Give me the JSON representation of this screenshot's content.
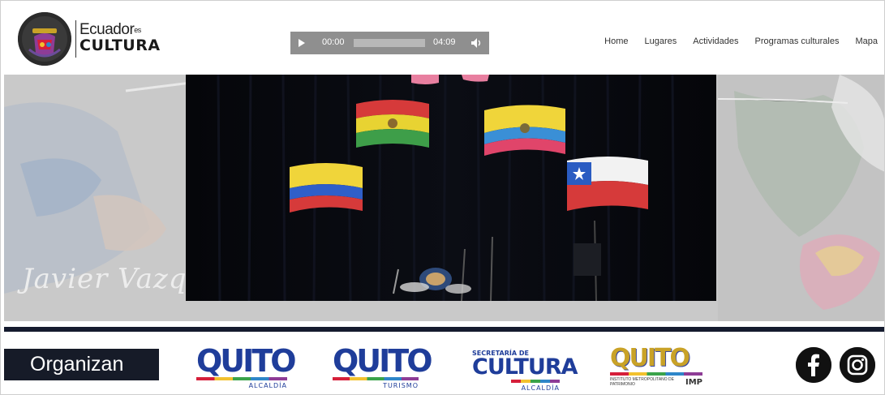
{
  "brand": {
    "line1": "Ecuador",
    "line1_suffix": "es",
    "line2": "CULTURA"
  },
  "player": {
    "current_time": "00:00",
    "total_time": "04:09",
    "progress": 0.0
  },
  "nav": {
    "items": [
      {
        "label": "Home"
      },
      {
        "label": "Lugares"
      },
      {
        "label": "Actividades"
      },
      {
        "label": "Programas culturales"
      },
      {
        "label": "Mapa"
      }
    ]
  },
  "hero": {
    "signature": "Javier Vazque"
  },
  "footer": {
    "organizan_label": "Organizan",
    "sponsors": [
      {
        "name": "QUITO",
        "sub": "ALCALDÍA"
      },
      {
        "name": "QUITO",
        "sub": "TURISMO"
      },
      {
        "top": "SECRETARÍA DE",
        "name": "CULTURA",
        "sub": "ALCALDÍA"
      },
      {
        "name": "QUITO",
        "sub_small": "INSTITUTO METROPOLITANO DE PATRIMONIO",
        "sub": "IMP"
      }
    ],
    "social": [
      {
        "icon": "facebook-icon"
      },
      {
        "icon": "instagram-icon"
      }
    ]
  },
  "colors": {
    "dark_navy": "#161b28",
    "player_gray": "#8f8f8f",
    "quito_blue": "#1f3d9a"
  }
}
